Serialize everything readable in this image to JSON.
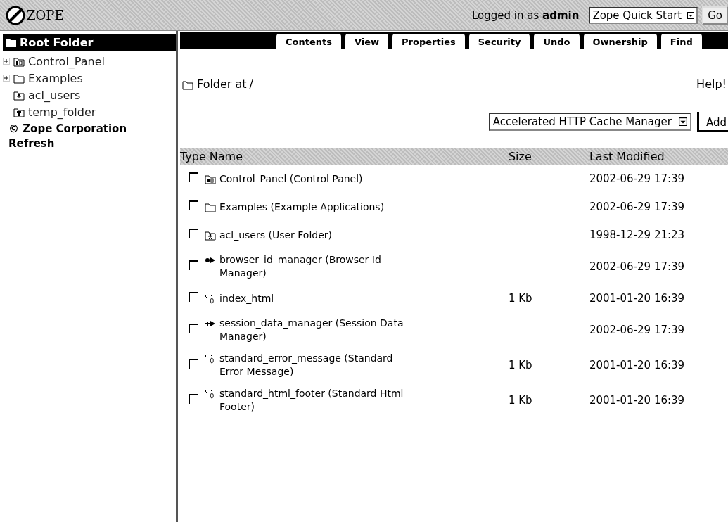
{
  "header": {
    "logo": "ZOPE",
    "login": "Logged in as **admin**",
    "quick_start": "Zope Quick Start",
    "go": "Go"
  },
  "sidebar": {
    "root": "Root Folder",
    "items": [
      {
        "label": "Control_Panel",
        "kind": "control-panel",
        "expandable": true
      },
      {
        "label": "Examples",
        "kind": "folder",
        "expandable": true
      },
      {
        "label": "acl_users",
        "kind": "user-folder",
        "expandable": false
      },
      {
        "label": "temp_folder",
        "kind": "temp-folder",
        "expandable": false
      }
    ],
    "copyright": "© Zope Corporation",
    "refresh": "Refresh"
  },
  "tabs": [
    {
      "label": "Contents"
    },
    {
      "label": "View"
    },
    {
      "label": "Properties"
    },
    {
      "label": "Security"
    },
    {
      "label": "Undo"
    },
    {
      "label": "Ownership"
    },
    {
      "label": "Find"
    }
  ],
  "location": {
    "title": "Folder at",
    "path": "/",
    "help": "Help!"
  },
  "add": {
    "type": "Accelerated HTTP Cache Manager",
    "button": "Add"
  },
  "table": {
    "columns": [
      "Type",
      "Name",
      "Size",
      "Last Modified"
    ],
    "rows": [
      {
        "checked": false,
        "kind": "control-panel",
        "name": "Control_Panel (Control Panel)",
        "size": "",
        "modified": "2002-06-29 17:39"
      },
      {
        "checked": false,
        "kind": "folder",
        "name": "Examples (Example Applications)",
        "size": "",
        "modified": "2002-06-29 17:39"
      },
      {
        "checked": false,
        "kind": "user-folder",
        "name": "acl_users (User Folder)",
        "size": "",
        "modified": "1998-12-29 21:23"
      },
      {
        "checked": false,
        "kind": "browser-id",
        "name": "browser_id_manager (Browser Id Manager)",
        "size": "",
        "modified": "2002-06-29 17:39"
      },
      {
        "checked": false,
        "kind": "dtml",
        "name": "index_html",
        "size": "1 Kb",
        "modified": "2001-01-20 16:39"
      },
      {
        "checked": false,
        "kind": "session-data",
        "name": "session_data_manager (Session Data Manager)",
        "size": "",
        "modified": "2002-06-29 17:39"
      },
      {
        "checked": false,
        "kind": "dtml",
        "name": "standard_error_message (Standard Error Message)",
        "size": "1 Kb",
        "modified": "2001-01-20 16:39"
      },
      {
        "checked": false,
        "kind": "dtml",
        "name": "standard_html_footer (Standard Html Footer)",
        "size": "1 Kb",
        "modified": "2001-01-20 16:39"
      }
    ]
  }
}
